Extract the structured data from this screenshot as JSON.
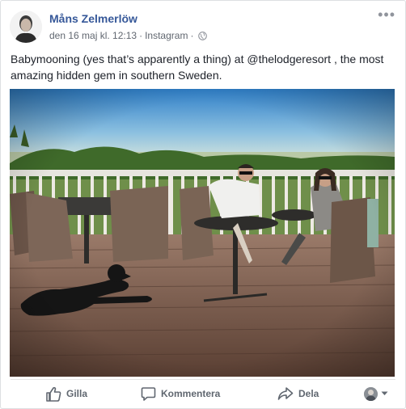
{
  "post": {
    "author": "Måns Zelmerlöw",
    "date": "den 16 maj kl. 12:13",
    "separator": "·",
    "source": "Instagram",
    "text": "Babymooning (yes that’s apparently a thing) at @thelodgeresort , the most amazing hidden gem in southern Sweden.",
    "more_label": "•••"
  },
  "actions": {
    "like": "Gilla",
    "comment": "Kommentera",
    "share": "Dela"
  },
  "icons": {
    "privacy": "globe-icon",
    "like": "thumbs-up-icon",
    "comment": "comment-icon",
    "share": "share-arrow-icon",
    "audience": "chevron-down-icon"
  },
  "colors": {
    "author_link": "#365899",
    "meta_text": "#616770",
    "action_text": "#606770"
  }
}
